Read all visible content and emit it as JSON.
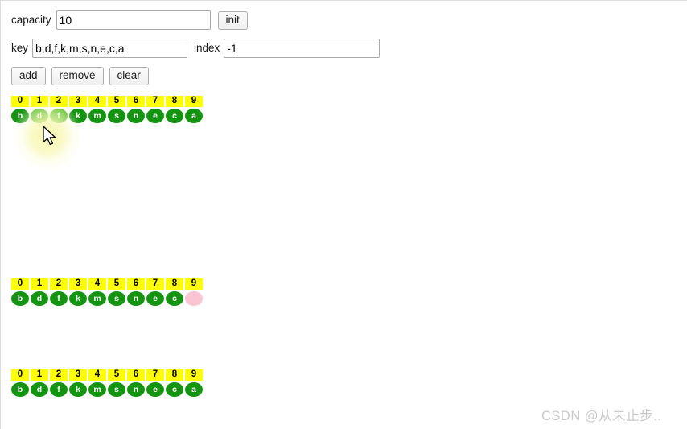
{
  "form": {
    "capacity": {
      "label": "capacity",
      "value": "10",
      "placeholder": ""
    },
    "init_button": "init",
    "key": {
      "label": "key",
      "value": "b,d,f,k,m,s,n,e,c,a",
      "placeholder": ""
    },
    "index": {
      "label": "index",
      "value": "-1",
      "placeholder": ""
    },
    "actions": [
      {
        "name": "add",
        "label": "add"
      },
      {
        "name": "remove",
        "label": "remove"
      },
      {
        "name": "clear",
        "label": "clear"
      }
    ]
  },
  "arrays": [
    {
      "name": "array-row-top",
      "indices": [
        "0",
        "1",
        "2",
        "3",
        "4",
        "5",
        "6",
        "7",
        "8",
        "9"
      ],
      "cells": [
        {
          "value": "b",
          "state": "filled"
        },
        {
          "value": "d",
          "state": "highlight"
        },
        {
          "value": "f",
          "state": "highlight"
        },
        {
          "value": "k",
          "state": "filled"
        },
        {
          "value": "m",
          "state": "filled"
        },
        {
          "value": "s",
          "state": "filled"
        },
        {
          "value": "n",
          "state": "filled"
        },
        {
          "value": "e",
          "state": "filled"
        },
        {
          "value": "c",
          "state": "filled"
        },
        {
          "value": "a",
          "state": "filled"
        }
      ]
    },
    {
      "name": "array-row-middle",
      "indices": [
        "0",
        "1",
        "2",
        "3",
        "4",
        "5",
        "6",
        "7",
        "8",
        "9"
      ],
      "cells": [
        {
          "value": "b",
          "state": "filled"
        },
        {
          "value": "d",
          "state": "filled"
        },
        {
          "value": "f",
          "state": "filled"
        },
        {
          "value": "k",
          "state": "filled"
        },
        {
          "value": "m",
          "state": "filled"
        },
        {
          "value": "s",
          "state": "filled"
        },
        {
          "value": "n",
          "state": "filled"
        },
        {
          "value": "e",
          "state": "filled"
        },
        {
          "value": "c",
          "state": "filled"
        },
        {
          "value": "",
          "state": "empty"
        }
      ]
    },
    {
      "name": "array-row-bottom",
      "indices": [
        "0",
        "1",
        "2",
        "3",
        "4",
        "5",
        "6",
        "7",
        "8",
        "9"
      ],
      "cells": [
        {
          "value": "b",
          "state": "filled"
        },
        {
          "value": "d",
          "state": "filled"
        },
        {
          "value": "f",
          "state": "filled"
        },
        {
          "value": "k",
          "state": "filled"
        },
        {
          "value": "m",
          "state": "filled"
        },
        {
          "value": "s",
          "state": "filled"
        },
        {
          "value": "n",
          "state": "filled"
        },
        {
          "value": "e",
          "state": "filled"
        },
        {
          "value": "c",
          "state": "filled"
        },
        {
          "value": "a",
          "state": "filled"
        }
      ]
    }
  ],
  "watermark": "CSDN @从未止步..",
  "colors": {
    "index_cell_bg": "#ffff00",
    "node_filled": "#139512",
    "node_highlight": "#4aba16",
    "node_empty": "#fbc4d4",
    "click_glow": "#f6f6a7",
    "watermark_text": "#c9c9c9"
  }
}
